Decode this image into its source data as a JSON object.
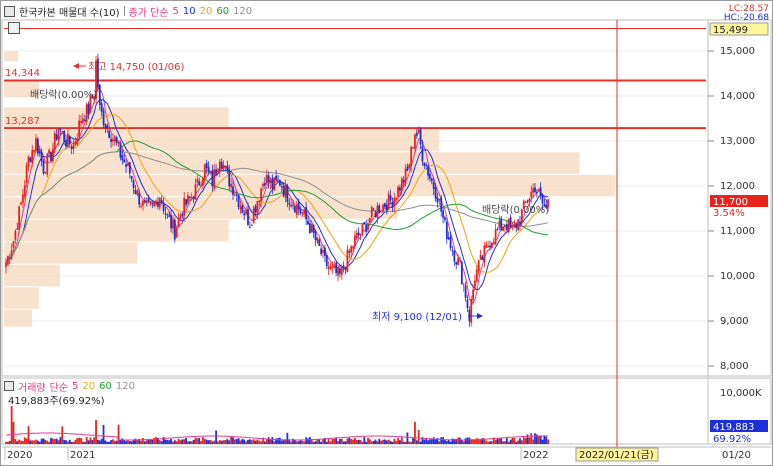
{
  "header": {
    "stock_name": "한국카본 매물대 수(10)",
    "ma_label": "종가 단순",
    "ma_periods": [
      "5",
      "10",
      "20",
      "60",
      "120"
    ],
    "ma_colors": [
      "#e6398e",
      "#1c2fd8",
      "#f2a20c",
      "#1e9e2b",
      "#909090"
    ]
  },
  "corner": {
    "lc": "LC:28.57",
    "hc": "HC:-20.68"
  },
  "volume_header": {
    "label": "거래량",
    "ma_label": "단순",
    "ma_periods": [
      "5",
      "20",
      "60",
      "120"
    ],
    "value_text": "419,883주(69.92%)"
  },
  "price_axis": {
    "ticks": [
      "15,000",
      "14,000",
      "13,000",
      "12,000",
      "11,000",
      "10,000",
      "9,000",
      "8,000"
    ],
    "top_label": "15,499",
    "current_label": "11,700",
    "change_label": "3.54%"
  },
  "volume_axis": {
    "top_label": "10,000K",
    "current_label": "419,883",
    "pct_label": "69.92%"
  },
  "annotations": {
    "high": "최고 14,750 (01/06)",
    "low": "최저 9,100 (12/01)",
    "dividend1": "배당락(0.00%)",
    "dividend2": "배당락(0.00%)",
    "level_14344": "14,344",
    "level_13287": "13,287"
  },
  "x_axis": {
    "labels": [
      "2020",
      "2021",
      "2022",
      "01/20"
    ],
    "cursor_date": "2022/01/21(금)"
  },
  "chart_data": {
    "type": "candlestick",
    "price_range": [
      7700,
      15600
    ],
    "horizontal_lines": [
      15499,
      14344,
      13287
    ],
    "high_point": {
      "value": 14750,
      "date": "01/06"
    },
    "low_point": {
      "value": 9100,
      "date": "12/01"
    },
    "current_price": 11700,
    "change_percent": 3.54,
    "volume_profile": [
      {
        "from": 14750,
        "to": 15000,
        "rel": 0.02
      },
      {
        "from": 13950,
        "to": 14350,
        "rel": 0.05
      },
      {
        "from": 13250,
        "to": 13750,
        "rel": 0.32
      },
      {
        "from": 12750,
        "to": 13250,
        "rel": 0.62
      },
      {
        "from": 12250,
        "to": 12750,
        "rel": 0.82
      },
      {
        "from": 11750,
        "to": 12250,
        "rel": 0.87
      },
      {
        "from": 11250,
        "to": 11750,
        "rel": 0.56
      },
      {
        "from": 10750,
        "to": 11250,
        "rel": 0.32
      },
      {
        "from": 10250,
        "to": 10750,
        "rel": 0.19
      },
      {
        "from": 9750,
        "to": 10250,
        "rel": 0.08
      },
      {
        "from": 9250,
        "to": 9750,
        "rel": 0.05
      },
      {
        "from": 8850,
        "to": 9250,
        "rel": 0.04
      }
    ],
    "price_path": [
      [
        0,
        10300
      ],
      [
        4,
        10800
      ],
      [
        8,
        11600
      ],
      [
        12,
        12600
      ],
      [
        16,
        13000
      ],
      [
        20,
        12400
      ],
      [
        24,
        12700
      ],
      [
        28,
        13300
      ],
      [
        32,
        13000
      ],
      [
        36,
        12900
      ],
      [
        40,
        13500
      ],
      [
        44,
        13700
      ],
      [
        47,
        14100
      ],
      [
        48,
        14750
      ],
      [
        50,
        13700
      ],
      [
        54,
        13300
      ],
      [
        58,
        13000
      ],
      [
        62,
        12600
      ],
      [
        66,
        12300
      ],
      [
        70,
        11800
      ],
      [
        74,
        11500
      ],
      [
        78,
        11500
      ],
      [
        82,
        11800
      ],
      [
        86,
        11300
      ],
      [
        90,
        11000
      ],
      [
        94,
        11500
      ],
      [
        98,
        11700
      ],
      [
        102,
        12000
      ],
      [
        106,
        12400
      ],
      [
        110,
        12100
      ],
      [
        114,
        12700
      ],
      [
        118,
        12200
      ],
      [
        122,
        11900
      ],
      [
        126,
        11500
      ],
      [
        130,
        11200
      ],
      [
        134,
        11700
      ],
      [
        138,
        12200
      ],
      [
        142,
        12000
      ],
      [
        146,
        12100
      ],
      [
        150,
        11800
      ],
      [
        154,
        11600
      ],
      [
        158,
        11400
      ],
      [
        162,
        11100
      ],
      [
        166,
        10700
      ],
      [
        170,
        10300
      ],
      [
        174,
        10100
      ],
      [
        178,
        10000
      ],
      [
        182,
        10400
      ],
      [
        186,
        10800
      ],
      [
        190,
        11000
      ],
      [
        194,
        11300
      ],
      [
        198,
        11500
      ],
      [
        202,
        11600
      ],
      [
        206,
        11700
      ],
      [
        210,
        12000
      ],
      [
        214,
        12300
      ],
      [
        218,
        13200
      ],
      [
        220,
        13100
      ],
      [
        222,
        12700
      ],
      [
        226,
        12200
      ],
      [
        230,
        11800
      ],
      [
        234,
        11100
      ],
      [
        238,
        10600
      ],
      [
        242,
        10200
      ],
      [
        245,
        9600
      ],
      [
        247,
        9100
      ],
      [
        250,
        10000
      ],
      [
        254,
        10400
      ],
      [
        258,
        10800
      ],
      [
        262,
        11000
      ],
      [
        266,
        11200
      ],
      [
        270,
        11000
      ],
      [
        274,
        11300
      ],
      [
        278,
        11700
      ],
      [
        282,
        12000
      ],
      [
        286,
        11600
      ],
      [
        289,
        11400
      ]
    ],
    "volume_series": "daily bars, spikes near the 2020 start, the 14,750 high and the 13,287 rebound"
  }
}
